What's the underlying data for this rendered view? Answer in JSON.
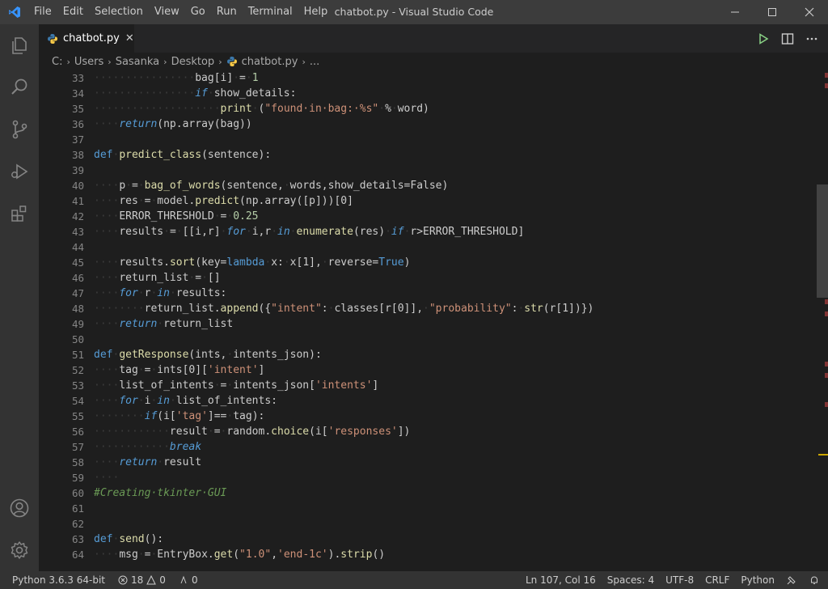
{
  "window": {
    "title": "chatbot.py - Visual Studio Code",
    "menu": [
      "File",
      "Edit",
      "Selection",
      "View",
      "Go",
      "Run",
      "Terminal",
      "Help"
    ]
  },
  "tabs": [
    {
      "label": "chatbot.py",
      "close": "✕",
      "icon": "python-icon"
    }
  ],
  "breadcrumbs": [
    "C:",
    "Users",
    "Sasanka",
    "Desktop",
    "chatbot.py",
    "..."
  ],
  "editor": {
    "line_numbers": [
      "33",
      "34",
      "35",
      "36",
      "37",
      "38",
      "39",
      "40",
      "41",
      "42",
      "43",
      "44",
      "45",
      "46",
      "47",
      "48",
      "49",
      "50",
      "51",
      "52",
      "53",
      "54",
      "55",
      "56",
      "57",
      "58",
      "59",
      "60",
      "61",
      "62",
      "63",
      "64"
    ],
    "lines": [
      [
        [
          "ws",
          "················"
        ],
        [
          "var",
          "bag[i]"
        ],
        [
          "ws",
          "·"
        ],
        [
          "op",
          "="
        ],
        [
          "ws",
          "·"
        ],
        [
          "num",
          "1"
        ]
      ],
      [
        [
          "ws",
          "················"
        ],
        [
          "ctl",
          "if"
        ],
        [
          "ws",
          "·"
        ],
        [
          "var",
          "show_details:"
        ]
      ],
      [
        [
          "ws",
          "····················"
        ],
        [
          "fn",
          "print"
        ],
        [
          "ws",
          "·"
        ],
        [
          "var",
          "("
        ],
        [
          "str",
          "\"found·in·bag:·%s\""
        ],
        [
          "ws",
          "·"
        ],
        [
          "op",
          "%"
        ],
        [
          "ws",
          "·"
        ],
        [
          "var",
          "word)"
        ]
      ],
      [
        [
          "ws",
          "····"
        ],
        [
          "ctl",
          "return"
        ],
        [
          "var",
          "(np.array(bag))"
        ]
      ],
      [],
      [
        [
          "kw",
          "def"
        ],
        [
          "ws",
          "·"
        ],
        [
          "fn",
          "predict_class"
        ],
        [
          "var",
          "(sentence):"
        ]
      ],
      [],
      [
        [
          "ws",
          "····"
        ],
        [
          "var",
          "p"
        ],
        [
          "ws",
          "·"
        ],
        [
          "op",
          "="
        ],
        [
          "ws",
          "·"
        ],
        [
          "fn",
          "bag_of_words"
        ],
        [
          "var",
          "(sentence,"
        ],
        [
          "ws",
          "·"
        ],
        [
          "var",
          "words,show_details=False)"
        ]
      ],
      [
        [
          "ws",
          "····"
        ],
        [
          "var",
          "res"
        ],
        [
          "ws",
          "·"
        ],
        [
          "op",
          "="
        ],
        [
          "ws",
          "·"
        ],
        [
          "var",
          "model."
        ],
        [
          "fn",
          "predict"
        ],
        [
          "var",
          "(np.array([p]))[0]"
        ]
      ],
      [
        [
          "ws",
          "····"
        ],
        [
          "var",
          "ERROR_THRESHOLD"
        ],
        [
          "ws",
          "·"
        ],
        [
          "op",
          "="
        ],
        [
          "ws",
          "·"
        ],
        [
          "num",
          "0.25"
        ]
      ],
      [
        [
          "ws",
          "····"
        ],
        [
          "var",
          "results"
        ],
        [
          "ws",
          "·"
        ],
        [
          "op",
          "="
        ],
        [
          "ws",
          "·"
        ],
        [
          "var",
          "[[i,r]"
        ],
        [
          "ws",
          "·"
        ],
        [
          "ctl",
          "for"
        ],
        [
          "ws",
          "·"
        ],
        [
          "var",
          "i,r"
        ],
        [
          "ws",
          "·"
        ],
        [
          "ctl",
          "in"
        ],
        [
          "ws",
          "·"
        ],
        [
          "fn",
          "enumerate"
        ],
        [
          "var",
          "(res)"
        ],
        [
          "ws",
          "·"
        ],
        [
          "ctl",
          "if"
        ],
        [
          "ws",
          "·"
        ],
        [
          "var",
          "r>ERROR_THRESHOLD]"
        ]
      ],
      [],
      [
        [
          "ws",
          "····"
        ],
        [
          "var",
          "results."
        ],
        [
          "fn",
          "sort"
        ],
        [
          "var",
          "(key="
        ],
        [
          "kw",
          "lambda"
        ],
        [
          "ws",
          "·"
        ],
        [
          "var",
          "x:"
        ],
        [
          "ws",
          "·"
        ],
        [
          "var",
          "x[1],"
        ],
        [
          "ws",
          "·"
        ],
        [
          "var",
          "reverse="
        ],
        [
          "kw",
          "True"
        ],
        [
          "var",
          ")"
        ]
      ],
      [
        [
          "ws",
          "····"
        ],
        [
          "var",
          "return_list"
        ],
        [
          "ws",
          "·"
        ],
        [
          "op",
          "="
        ],
        [
          "ws",
          "·"
        ],
        [
          "var",
          "[]"
        ]
      ],
      [
        [
          "ws",
          "····"
        ],
        [
          "ctl",
          "for"
        ],
        [
          "ws",
          "·"
        ],
        [
          "var",
          "r"
        ],
        [
          "ws",
          "·"
        ],
        [
          "ctl",
          "in"
        ],
        [
          "ws",
          "·"
        ],
        [
          "var",
          "results:"
        ]
      ],
      [
        [
          "ws",
          "········"
        ],
        [
          "var",
          "return_list."
        ],
        [
          "fn",
          "append"
        ],
        [
          "var",
          "({"
        ],
        [
          "str",
          "\"intent\""
        ],
        [
          "var",
          ":"
        ],
        [
          "ws",
          "·"
        ],
        [
          "var",
          "classes[r[0]],"
        ],
        [
          "ws",
          "·"
        ],
        [
          "str",
          "\"probability\""
        ],
        [
          "var",
          ":"
        ],
        [
          "ws",
          "·"
        ],
        [
          "fn",
          "str"
        ],
        [
          "var",
          "(r[1])})"
        ]
      ],
      [
        [
          "ws",
          "····"
        ],
        [
          "ctl",
          "return"
        ],
        [
          "ws",
          "·"
        ],
        [
          "var",
          "return_list"
        ]
      ],
      [],
      [
        [
          "kw",
          "def"
        ],
        [
          "ws",
          "·"
        ],
        [
          "fn",
          "getResponse"
        ],
        [
          "var",
          "(ints,"
        ],
        [
          "ws",
          "·"
        ],
        [
          "var",
          "intents_json):"
        ]
      ],
      [
        [
          "ws",
          "····"
        ],
        [
          "var",
          "tag"
        ],
        [
          "ws",
          "·"
        ],
        [
          "op",
          "="
        ],
        [
          "ws",
          "·"
        ],
        [
          "var",
          "ints[0]["
        ],
        [
          "str",
          "'intent'"
        ],
        [
          "var",
          "]"
        ]
      ],
      [
        [
          "ws",
          "····"
        ],
        [
          "var",
          "list_of_intents"
        ],
        [
          "ws",
          "·"
        ],
        [
          "op",
          "="
        ],
        [
          "ws",
          "·"
        ],
        [
          "var",
          "intents_json["
        ],
        [
          "str",
          "'intents'"
        ],
        [
          "var",
          "]"
        ]
      ],
      [
        [
          "ws",
          "····"
        ],
        [
          "ctl",
          "for"
        ],
        [
          "ws",
          "·"
        ],
        [
          "var",
          "i"
        ],
        [
          "ws",
          "·"
        ],
        [
          "ctl",
          "in"
        ],
        [
          "ws",
          "·"
        ],
        [
          "var",
          "list_of_intents:"
        ]
      ],
      [
        [
          "ws",
          "········"
        ],
        [
          "ctl",
          "if"
        ],
        [
          "var",
          "(i["
        ],
        [
          "str",
          "'tag'"
        ],
        [
          "var",
          "]=="
        ],
        [
          "ws",
          "·"
        ],
        [
          "var",
          "tag):"
        ]
      ],
      [
        [
          "ws",
          "············"
        ],
        [
          "var",
          "result"
        ],
        [
          "ws",
          "·"
        ],
        [
          "op",
          "="
        ],
        [
          "ws",
          "·"
        ],
        [
          "var",
          "random."
        ],
        [
          "fn",
          "choice"
        ],
        [
          "var",
          "(i["
        ],
        [
          "str",
          "'responses'"
        ],
        [
          "var",
          "])"
        ]
      ],
      [
        [
          "ws",
          "············"
        ],
        [
          "ctl",
          "break"
        ]
      ],
      [
        [
          "ws",
          "····"
        ],
        [
          "ctl",
          "return"
        ],
        [
          "ws",
          "·"
        ],
        [
          "var",
          "result"
        ]
      ],
      [
        [
          "ws",
          "····"
        ]
      ],
      [
        [
          "com",
          "#Creating·tkinter·GUI"
        ]
      ],
      [],
      [],
      [
        [
          "kw",
          "def"
        ],
        [
          "ws",
          "·"
        ],
        [
          "fn",
          "send"
        ],
        [
          "var",
          "():"
        ]
      ],
      [
        [
          "ws",
          "····"
        ],
        [
          "var",
          "msg"
        ],
        [
          "ws",
          "·"
        ],
        [
          "op",
          "="
        ],
        [
          "ws",
          "·"
        ],
        [
          "var",
          "EntryBox."
        ],
        [
          "fn",
          "get"
        ],
        [
          "var",
          "("
        ],
        [
          "str",
          "\"1.0\""
        ],
        [
          "var",
          ","
        ],
        [
          "str",
          "'end-1c'"
        ],
        [
          "var",
          ")."
        ],
        [
          "fn",
          "strip"
        ],
        [
          "var",
          "()"
        ]
      ]
    ]
  },
  "statusbar": {
    "interpreter": "Python 3.6.3 64-bit",
    "errors": "18",
    "warnings": "0",
    "ports": "0",
    "cursor": "Ln 107, Col 16",
    "spaces": "Spaces: 4",
    "encoding": "UTF-8",
    "eol": "CRLF",
    "language": "Python"
  },
  "colors": {
    "accent": "#007acc",
    "editor_bg": "#1e1e1e",
    "statusbar_bg": "#333333"
  }
}
